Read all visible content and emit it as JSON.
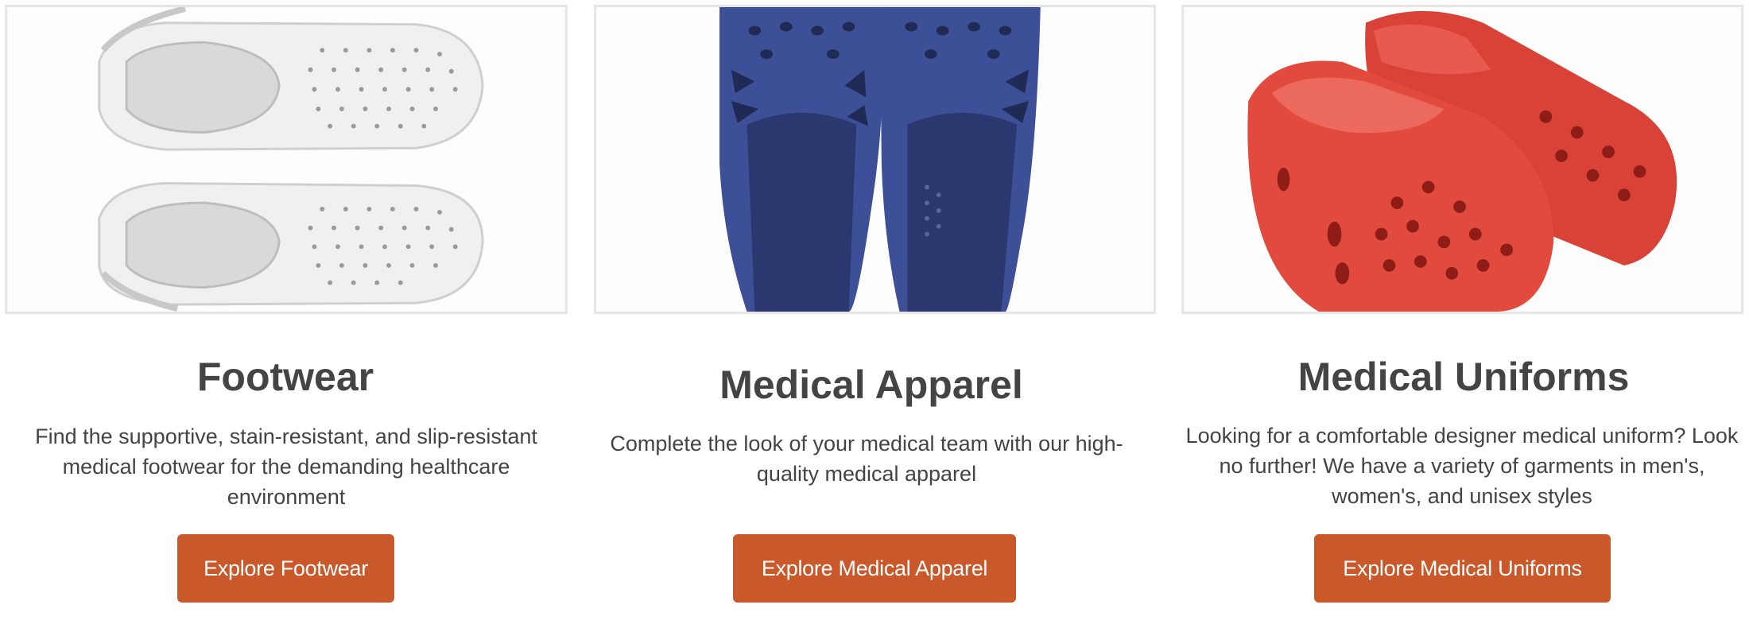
{
  "categories": [
    {
      "title": "Footwear",
      "description": "Find the supportive, stain-resistant, and slip-resistant medical footwear for the demanding healthcare environment",
      "button_label": "Explore Footwear",
      "image_icon": "white-clogs-image"
    },
    {
      "title": "Medical Apparel",
      "description": "Complete the look of your medical team with our high-quality medical apparel",
      "button_label": "Explore Medical Apparel",
      "image_icon": "blue-clogs-image"
    },
    {
      "title": "Medical Uniforms",
      "description": "Looking for a comfortable designer medical uniform? Look no further! We have a variety of garments in men's, women's, and unisex styles",
      "button_label": "Explore Medical Uniforms",
      "image_icon": "red-clogs-image"
    }
  ],
  "colors": {
    "button_background": "#c9582a",
    "button_text": "#ffffff",
    "heading_text": "#444444",
    "image_border": "#e6e6e6"
  }
}
